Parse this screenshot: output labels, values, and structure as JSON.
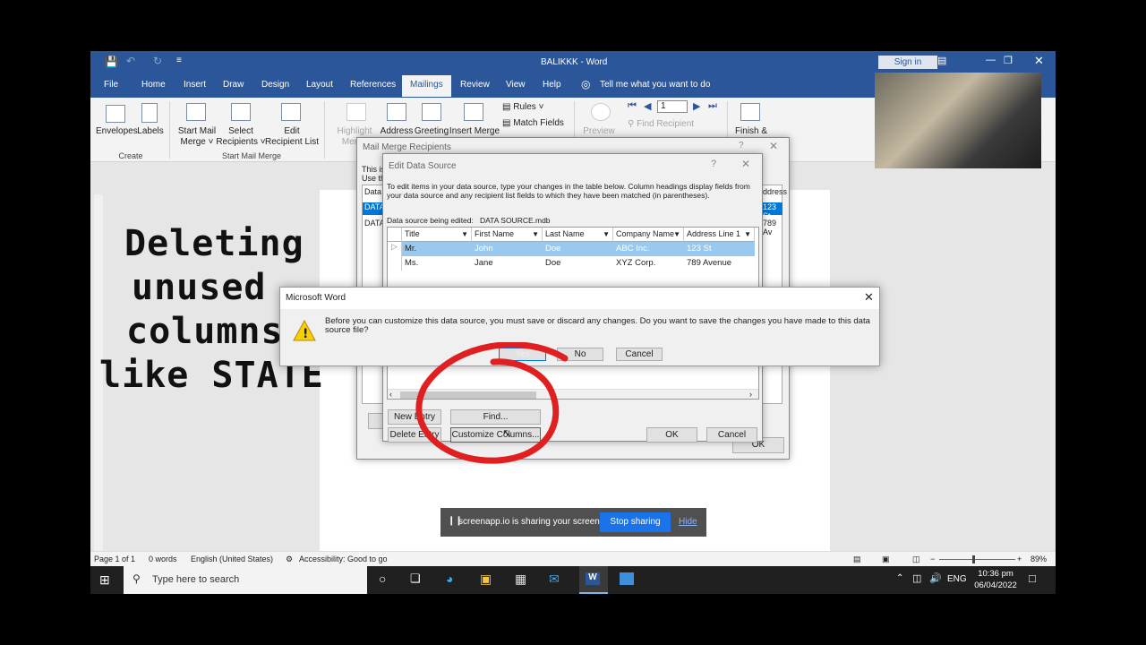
{
  "window": {
    "title": "BALIKKK - Word",
    "signin": "Sign in",
    "undo_icon": "undo-icon",
    "redo_icon": "redo-icon"
  },
  "tabs": [
    "File",
    "Home",
    "Insert",
    "Draw",
    "Design",
    "Layout",
    "References",
    "Mailings",
    "Review",
    "View",
    "Help"
  ],
  "tell_me": "Tell me what you want to do",
  "ribbon": {
    "envelopes": "Envelopes",
    "labels": "Labels",
    "create_group": "Create",
    "start_mail": "Start Mail",
    "merge": "Merge",
    "select": "Select",
    "recipients": "Recipients",
    "edit": "Edit",
    "recipient_list": "Recipient List",
    "start_group": "Start Mail Merge",
    "highlight": "Highlight",
    "merge_fields": "Merge",
    "address": "Address",
    "greeting": "Greeting",
    "insert_merge": "Insert Merge",
    "rules": "Rules",
    "match_fields": "Match Fields",
    "preview": "Preview",
    "record": "1",
    "find_recipient": "Find Recipient",
    "finish": "Finish &"
  },
  "overlay_text": [
    "Deleting",
    "unused",
    "columns",
    "like STATE"
  ],
  "mmr": {
    "title": "Mail Merge Recipients",
    "this_is": "This is",
    "use_the": "Use th",
    "data_col": "Data",
    "row1": "DATA",
    "row2": "DATA",
    "addr_hdr": "ddress",
    "addr1": "123 St",
    "addr2": "789 Av",
    "ok": "OK"
  },
  "eds": {
    "title": "Edit Data Source",
    "desc": "To edit items in your data source, type your changes in the table below. Column headings display fields from your data source and any recipient list fields to which they have been matched (in parentheses).",
    "source_label": "Data source being edited:",
    "source_file": "DATA SOURCE.mdb",
    "columns": [
      "Title",
      "First Name",
      "Last Name",
      "Company Name",
      "Address Line 1"
    ],
    "rows": [
      [
        "Mr.",
        "John",
        "Doe",
        "ABC Inc.",
        "123 St"
      ],
      [
        "Ms.",
        "Jane",
        "Doe",
        "XYZ Corp.",
        "789 Avenue"
      ]
    ],
    "new_entry": "New Entry",
    "delete_entry": "Delete Entry",
    "find": "Find...",
    "customize": "Customize Columns...",
    "ok": "OK",
    "cancel": "Cancel"
  },
  "msg": {
    "title": "Microsoft Word",
    "text": "Before you can customize this data source, you must save or discard any changes. Do you want to save the changes you have made to this data source file?",
    "yes": "Yes",
    "no": "No",
    "cancel": "Cancel"
  },
  "share": {
    "text": "screenapp.io is sharing your screen.",
    "stop": "Stop sharing",
    "hide": "Hide"
  },
  "status": {
    "page": "Page 1 of 1",
    "words": "0 words",
    "lang": "English (United States)",
    "access": "Accessibility: Good to go",
    "zoom": "89%"
  },
  "taskbar": {
    "search": "Type here to search",
    "lang": "ENG",
    "time": "10:36 pm",
    "date": "06/04/2022"
  },
  "colors": {
    "word_blue": "#2b579a",
    "selection": "#99c9ef",
    "annotation_red": "#e02020",
    "focus": "#0078d7"
  }
}
